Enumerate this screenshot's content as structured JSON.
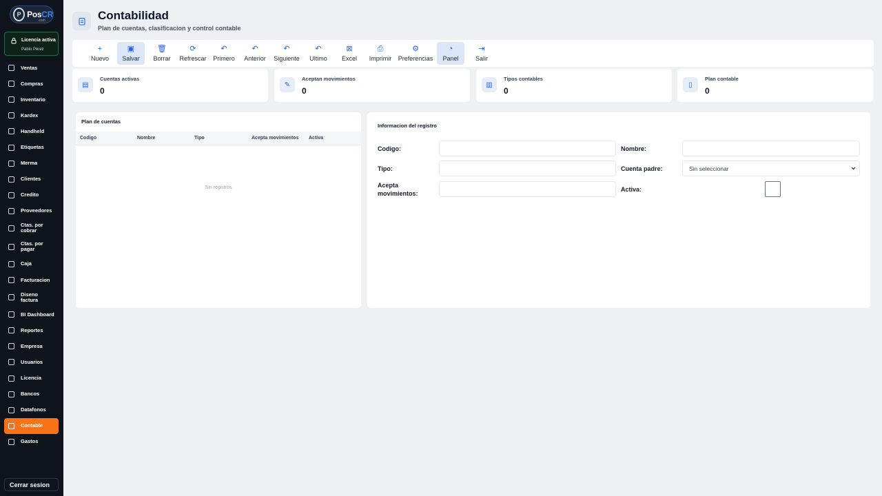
{
  "brand": {
    "name_prefix": "Pos",
    "name_suffix": "CR",
    "sub": ".com",
    "mark": "P"
  },
  "license": {
    "title": "Licencia activa",
    "user": "Pablo Perez"
  },
  "nav": [
    {
      "label": "Ventas",
      "icon": "cart-icon"
    },
    {
      "label": "Compras",
      "icon": "receipt-icon"
    },
    {
      "label": "Inventario",
      "icon": "box-icon"
    },
    {
      "label": "Kardex",
      "icon": "chart-icon"
    },
    {
      "label": "Handheld",
      "icon": "scanner-icon"
    },
    {
      "label": "Etiquetas",
      "icon": "tag-icon"
    },
    {
      "label": "Merma",
      "icon": "trash-icon"
    },
    {
      "label": "Clientes",
      "icon": "user-icon"
    },
    {
      "label": "Credito",
      "icon": "document-icon"
    },
    {
      "label": "Proveedores",
      "icon": "users-icon"
    },
    {
      "label": "Ctas. por cobrar",
      "icon": "download-icon"
    },
    {
      "label": "Ctas. por pagar",
      "icon": "upload-icon"
    },
    {
      "label": "Caja",
      "icon": "cash-icon"
    },
    {
      "label": "Facturacion",
      "icon": "file-icon"
    },
    {
      "label": "Diseno factura",
      "icon": "pen-icon"
    },
    {
      "label": "BI Dashboard",
      "icon": "gauge-icon"
    },
    {
      "label": "Reportes",
      "icon": "bar-chart-icon"
    },
    {
      "label": "Empresa",
      "icon": "gear-icon"
    },
    {
      "label": "Usuarios",
      "icon": "user-icon"
    },
    {
      "label": "Licencia",
      "icon": "lock-icon"
    },
    {
      "label": "Bancos",
      "icon": "bank-icon"
    },
    {
      "label": "Datafonos",
      "icon": "card-icon"
    },
    {
      "label": "Contable",
      "icon": "clipboard-icon",
      "active": true
    },
    {
      "label": "Gastos",
      "icon": "wallet-icon"
    }
  ],
  "logout": "Cerrar sesion",
  "header": {
    "title": "Contabilidad",
    "subtitle": "Plan de cuentas, clasificacion y control contable"
  },
  "toolbar": [
    {
      "label": "Nuevo",
      "glyph": "+"
    },
    {
      "label": "Salvar",
      "glyph": "▣",
      "active": true
    },
    {
      "label": "Borrar",
      "glyph": "🗑"
    },
    {
      "label": "Refrescar",
      "glyph": "⟳"
    },
    {
      "label": "Primero",
      "glyph": "↶"
    },
    {
      "label": "Anterior",
      "glyph": "↶"
    },
    {
      "label": "Siguiente",
      "glyph": "↶"
    },
    {
      "label": "Ultimo",
      "glyph": "↶"
    },
    {
      "label": "Excel",
      "glyph": "⊠"
    },
    {
      "label": "Imprimir",
      "glyph": "⎙"
    },
    {
      "label": "Preferencias",
      "glyph": "⚙"
    },
    {
      "label": "Panel",
      "glyph": "◔",
      "active": true
    },
    {
      "label": "Salir",
      "glyph": "⇥"
    }
  ],
  "stats": [
    {
      "label": "Cuentas activas",
      "value": "0",
      "glyph": "▤"
    },
    {
      "label": "Aceptan movimientos",
      "value": "0",
      "glyph": "✎"
    },
    {
      "label": "Tipos contables",
      "value": "0",
      "glyph": "▥"
    },
    {
      "label": "Plan contable",
      "value": "0",
      "glyph": "▯"
    }
  ],
  "accounts": {
    "title": "Plan de cuentas",
    "columns": [
      "Codigo",
      "Nombre",
      "Tipo",
      "Acepta movimientos",
      "Activa"
    ],
    "empty": "Sin registros"
  },
  "record": {
    "title": "Informacion del registro",
    "codigo_label": "Codigo:",
    "nombre_label": "Nombre:",
    "tipo_label": "Tipo:",
    "cuenta_padre_label": "Cuenta padre:",
    "cuenta_padre_value": "Sin seleccionar",
    "acepta_label": "Acepta movimientos:",
    "activa_label": "Activa:",
    "codigo_value": "",
    "nombre_value": "",
    "tipo_value": "",
    "acepta_value": "",
    "activa_checked": false
  },
  "colors": {
    "accent": "#f97316",
    "primary": "#2563eb",
    "sidebar": "#0f141c"
  }
}
